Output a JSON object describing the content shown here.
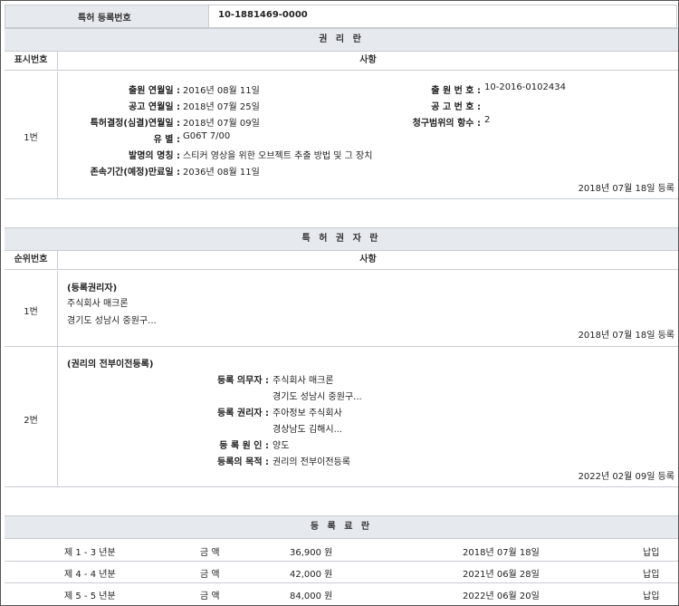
{
  "header": {
    "label": "특허 등록번호",
    "value": "10-1881469-0000"
  },
  "rights": {
    "section_title": "권 리 란",
    "col_num": "표시번호",
    "col_subject": "사항",
    "row": {
      "num": "1번",
      "fields": [
        {
          "label": "출원 연월일 :",
          "value": "2016년 08월 11일"
        },
        {
          "label": "공고 연월일 :",
          "value": "2018년 07월 25일"
        },
        {
          "label": "특허결정(심결)연월일 :",
          "value": "2018년 07월 09일"
        },
        {
          "label": "유 별 :",
          "value": "G06T 7/00"
        },
        {
          "label": "발명의 명칭 :",
          "value": "스티커 영상을 위한 오브젝트 추출 방법 및 그 장치"
        },
        {
          "label": "존속기간(예정)만료일 :",
          "value": "2036년 08월 11일"
        }
      ],
      "right_fields": [
        {
          "label": "출 원 번 호 :",
          "value": "10-2016-0102434"
        },
        {
          "label": "공 고 번 호 :",
          "value": ""
        },
        {
          "label": "청구범위의 항수 :",
          "value": "2"
        }
      ],
      "registered": "2018년 07월 18일 등록"
    }
  },
  "holders": {
    "section_title": "특 허 권 자 란",
    "col_num": "순위번호",
    "col_subject": "사항",
    "rows": [
      {
        "num": "1번",
        "heading": "(등록권리자)",
        "lines": [
          "주식회사 매크론",
          "경기도 성남시 중원구..."
        ],
        "registered": "2018년 07월 18일 등록"
      },
      {
        "num": "2번",
        "heading": "(권리의 전부이전등록)",
        "fields": [
          {
            "label": "등록 의무자 :",
            "value": "주식회사 매크론"
          },
          {
            "label": "",
            "value": "경기도 성남시 중원구..."
          },
          {
            "label": "등록 권리자 :",
            "value": "주아정보 주식회사"
          },
          {
            "label": "",
            "value": "경상남도 김해시..."
          },
          {
            "label": "등 록 원 인 :",
            "value": "양도"
          },
          {
            "label": "등록의 목적 :",
            "value": "권리의 전부이전등록"
          }
        ],
        "registered": "2022년 02월 09일 등록"
      }
    ]
  },
  "fees": {
    "section_title": "등 록 료 란",
    "rows": [
      {
        "period": "제 1 - 3 년분",
        "amount_label": "금 액",
        "amount": "36,900 원",
        "date": "2018년 07월 18일",
        "status": "납입"
      },
      {
        "period": "제 4 - 4 년분",
        "amount_label": "금 액",
        "amount": "42,000 원",
        "date": "2021년 06월 28일",
        "status": "납입"
      },
      {
        "period": "제 5 - 5 년분",
        "amount_label": "금 액",
        "amount": "84,000 원",
        "date": "2022년 06월 20일",
        "status": "납입"
      }
    ]
  }
}
